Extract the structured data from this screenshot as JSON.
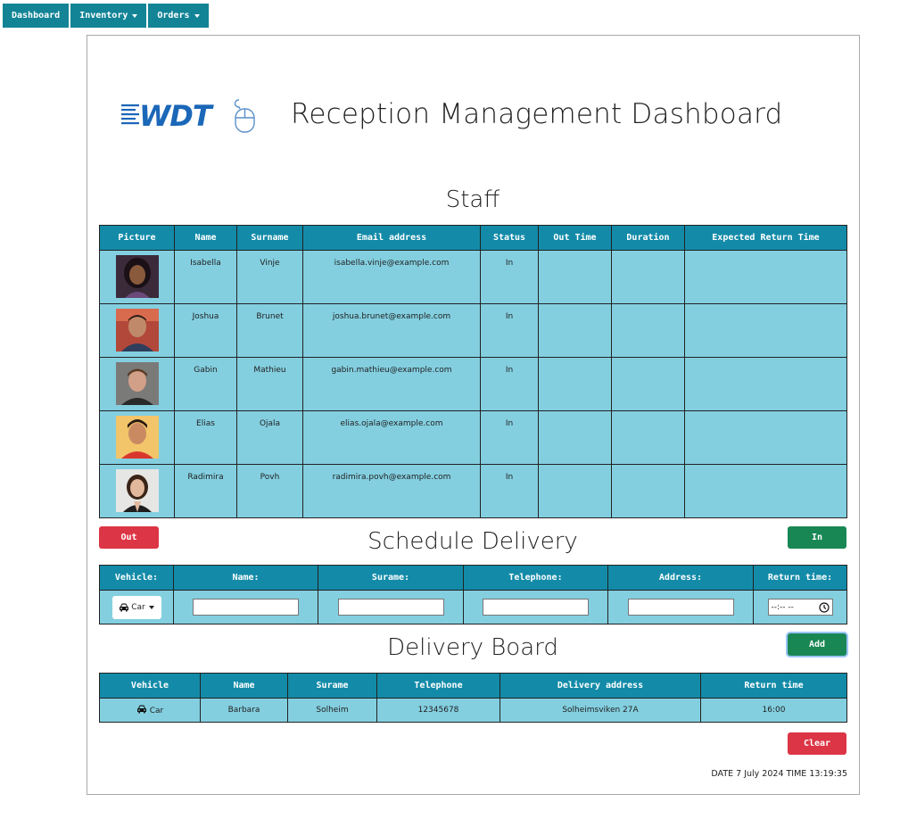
{
  "nav": {
    "dashboard": "Dashboard",
    "inventory": "Inventory",
    "orders": "Orders"
  },
  "header": {
    "logo_text": "WDT",
    "title": "Reception Management Dashboard"
  },
  "staff": {
    "title": "Staff",
    "columns": [
      "Picture",
      "Name",
      "Surname",
      "Email address",
      "Status",
      "Out Time",
      "Duration",
      "Expected Return Time"
    ],
    "rows": [
      {
        "name": "Isabella",
        "surname": "Vinje",
        "email": "isabella.vinje@example.com",
        "status": "In",
        "out_time": "",
        "duration": "",
        "expected_return": ""
      },
      {
        "name": "Joshua",
        "surname": "Brunet",
        "email": "joshua.brunet@example.com",
        "status": "In",
        "out_time": "",
        "duration": "",
        "expected_return": ""
      },
      {
        "name": "Gabin",
        "surname": "Mathieu",
        "email": "gabin.mathieu@example.com",
        "status": "In",
        "out_time": "",
        "duration": "",
        "expected_return": ""
      },
      {
        "name": "Elias",
        "surname": "Ojala",
        "email": "elias.ojala@example.com",
        "status": "In",
        "out_time": "",
        "duration": "",
        "expected_return": ""
      },
      {
        "name": "Radimira",
        "surname": "Povh",
        "email": "radimira.povh@example.com",
        "status": "In",
        "out_time": "",
        "duration": "",
        "expected_return": ""
      }
    ]
  },
  "buttons": {
    "out": "Out",
    "in": "In",
    "add": "Add",
    "clear": "Clear"
  },
  "schedule": {
    "title": "Schedule Delivery",
    "columns": [
      "Vehicle:",
      "Name:",
      "Surame:",
      "Telephone:",
      "Address:",
      "Return time:"
    ],
    "vehicle_selected": "Car",
    "vehicle_icon": "car-icon",
    "name_value": "",
    "surname_value": "",
    "telephone_value": "",
    "address_value": "",
    "return_time_placeholder": "--:-- --"
  },
  "board": {
    "title": "Delivery Board",
    "columns": [
      "Vehicle",
      "Name",
      "Surame",
      "Telephone",
      "Delivery address",
      "Return time"
    ],
    "rows": [
      {
        "vehicle": "Car",
        "name": "Barbara",
        "surname": "Solheim",
        "telephone": "12345678",
        "address": "Solheimsviken 27A",
        "return_time": "16:00"
      }
    ]
  },
  "footer": {
    "datetime": "DATE 7 July 2024 TIME 13:19:35"
  },
  "colors": {
    "nav": "#138496",
    "header_cell": "#138ba8",
    "body_cell": "#83cfe0",
    "danger": "#dc3545",
    "success": "#198754"
  }
}
